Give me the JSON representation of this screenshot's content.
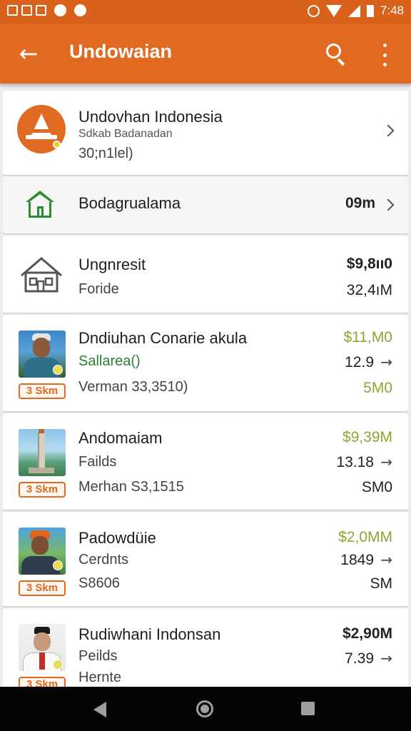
{
  "status_bar": {
    "time": "7:48"
  },
  "app_bar": {
    "title": "Undowaian"
  },
  "profile": {
    "name": "Undovhan Indonesia",
    "subtitle": "Sdkab Badanadan",
    "detail": "30;n1lel)"
  },
  "summary_row": {
    "label": "Bodagrualama",
    "value": "09m"
  },
  "property_row": {
    "title": "Ungnresit",
    "subtitle": "Foride",
    "value_top": "$9,8ıı0",
    "value_bottom": "32,4ıM"
  },
  "items": [
    {
      "title": "Dndiuhan Conarie akula",
      "subtitle": "Sallarea()",
      "detail": "Verman 33,3510)",
      "tag": "3 Skm",
      "value_top": "$11,M0",
      "value_mid": "12.9",
      "value_bottom": "5M0",
      "arrow": "→"
    },
    {
      "title": "Andomaiam",
      "subtitle": "Failds",
      "detail": "Merhan S3,1515",
      "tag": "3 Skm",
      "value_top": "$9,39M",
      "value_mid": "13.18",
      "value_bottom": "SM0",
      "arrow": "→"
    },
    {
      "title": "Padowdüie",
      "subtitle": "Cerdnts",
      "detail": "S8606",
      "tag": "3 Skm",
      "value_top": "$2,0MM",
      "value_mid": "1849",
      "value_bottom": "SM",
      "arrow": "→"
    },
    {
      "title": "Rudiwhani Indonsan",
      "subtitle": "Peilds",
      "detail": "Hernte",
      "tag": "3 Skm",
      "value_top": "$2,90M",
      "value_mid": "7.39",
      "value_bottom": "",
      "arrow": "→"
    }
  ],
  "icons": {
    "back": "arrow-left-icon",
    "search": "search-icon",
    "more": "more-vertical-icon"
  },
  "colors": {
    "primary": "#e26a20",
    "status_bar": "#d9621a",
    "positive": "#2e7d32",
    "value_green": "#8aa832"
  }
}
